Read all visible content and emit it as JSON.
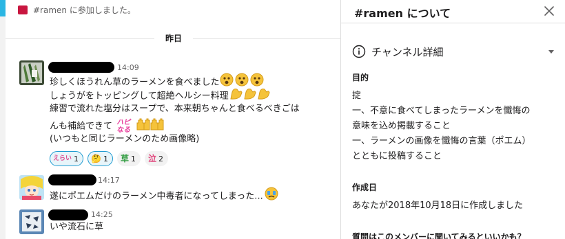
{
  "channel": {
    "name": "ramen",
    "hash": "#"
  },
  "messages": {
    "join_notice": "#ramen に参加しました。",
    "day_divider": "昨日",
    "list": [
      {
        "time": "14:09",
        "lines": [
          "珍しくほうれん草のラーメンを食べました",
          "しょうがをトッピングして超絶ヘルシー料理",
          "練習で流れた塩分はスープで、本来朝ちゃんと食べるべきごは",
          "んも補給できて",
          "(いつもと同じラーメンのため画像略)"
        ],
        "sticker_text": "ハピなる",
        "reactions": [
          {
            "label": "えらい",
            "count": "1",
            "mine": true
          },
          {
            "label": "🤔",
            "count": "1",
            "mine": true
          },
          {
            "label": "草",
            "count": "1",
            "mine": false
          },
          {
            "label": "泣",
            "count": "2",
            "mine": false
          }
        ]
      },
      {
        "time": "14:17",
        "lines": [
          "遂にポエムだけのラーメン中毒者になってしまった..."
        ]
      },
      {
        "time": "14:25",
        "lines": [
          "いや流石に草"
        ]
      }
    ]
  },
  "details": {
    "title_suffix": "について",
    "section_title": "チャンネル詳細",
    "purpose_label": "目的",
    "purpose_lines": [
      "掟",
      "一、不意に食べてしまったラーメンを懺悔の",
      "意味を込め掲載すること",
      "一、ラーメンの画像を懺悔の言葉（ポエム）",
      "とともに投稿すること"
    ],
    "created_label": "作成日",
    "created_text": "あなたが2018年10月18日に作成しました",
    "question_text": "質問はこのメンバーに聞いてみるといいかも？"
  },
  "icons": [
    "channel-color-icon",
    "info-icon",
    "caret-down-icon",
    "close-icon",
    "sweat-emoji-icon",
    "flex-emoji-icon",
    "raised-hands-emoji-icon",
    "crying-emoji-icon"
  ],
  "colors": {
    "link_blue": "#1d9bd1",
    "channel_red": "#c8163f",
    "accent_cyan": "#2bb6e3"
  }
}
